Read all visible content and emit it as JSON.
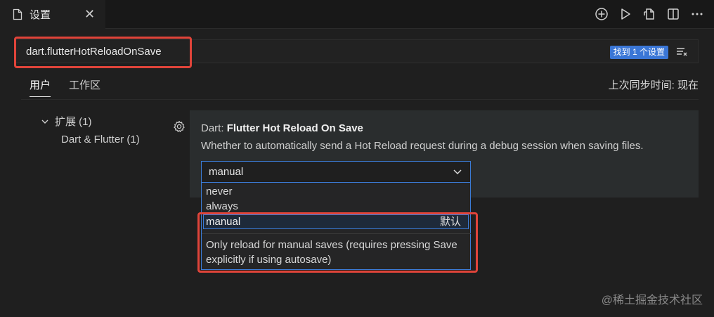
{
  "tab": {
    "title": "设置",
    "close": "✕"
  },
  "toolbar": {
    "icons": [
      "add-circle-icon",
      "run-icon",
      "open-json-icon",
      "split-editor-icon",
      "more-icon"
    ]
  },
  "search": {
    "value": "dart.flutterHotReloadOnSave",
    "result_badge": "找到 1 个设置"
  },
  "scope_tabs": [
    {
      "label": "用户",
      "active": true
    },
    {
      "label": "工作区",
      "active": false
    }
  ],
  "sync_status": "上次同步时间: 现在",
  "toc": {
    "group_label": "扩展 (1)",
    "child_label": "Dart & Flutter (1)"
  },
  "setting": {
    "category": "Dart: ",
    "name": "Flutter Hot Reload On Save",
    "description": "Whether to automatically send a Hot Reload request during a debug session when saving files.",
    "selected_value": "manual",
    "options": [
      "never",
      "always",
      "manual"
    ],
    "default_tag": "默认",
    "option_description": "Only reload for manual saves (requires pressing Save explicitly if using autosave)"
  },
  "watermark": "@稀土掘金技术社区",
  "colors": {
    "accent": "#3b7bd6",
    "highlight": "#e0443a"
  }
}
